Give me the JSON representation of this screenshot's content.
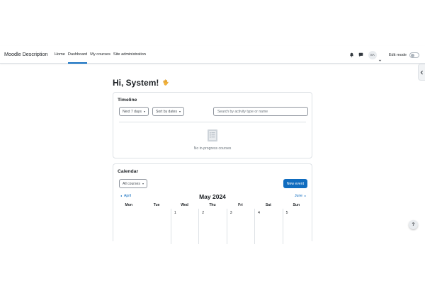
{
  "navbar": {
    "site_name": "Moodle Description",
    "items": [
      {
        "label": "Home",
        "active": false
      },
      {
        "label": "Dashboard",
        "active": true
      },
      {
        "label": "My courses",
        "active": false
      },
      {
        "label": "Site administration",
        "active": false
      }
    ],
    "avatar_initials": "SA",
    "edit_mode_label": "Edit mode",
    "edit_mode_on": false,
    "icons": [
      "bell-icon",
      "chat-icon",
      "chevron-down-icon"
    ]
  },
  "greeting": {
    "text": "Hi, System!",
    "icon": "wave-hand-icon"
  },
  "timeline": {
    "title": "Timeline",
    "filter_label": "Next 7 days",
    "sort_label": "Sort by dates",
    "search_placeholder": "Search by activity type or name",
    "empty_text": "No in-progress courses"
  },
  "calendar": {
    "title": "Calendar",
    "course_filter": "All courses",
    "new_event_label": "New event",
    "prev_month": "April",
    "next_month": "June",
    "month_title": "May 2024",
    "weekdays": [
      "Mon",
      "Tue",
      "Wed",
      "Thu",
      "Fri",
      "Sat",
      "Sun"
    ],
    "first_week": [
      "",
      "",
      "1",
      "2",
      "3",
      "4",
      "5"
    ]
  },
  "help_button": "?",
  "colors": {
    "accent": "#0f6cbf",
    "border": "#dee2e6",
    "text": "#1d2125",
    "muted": "#6a737b"
  }
}
